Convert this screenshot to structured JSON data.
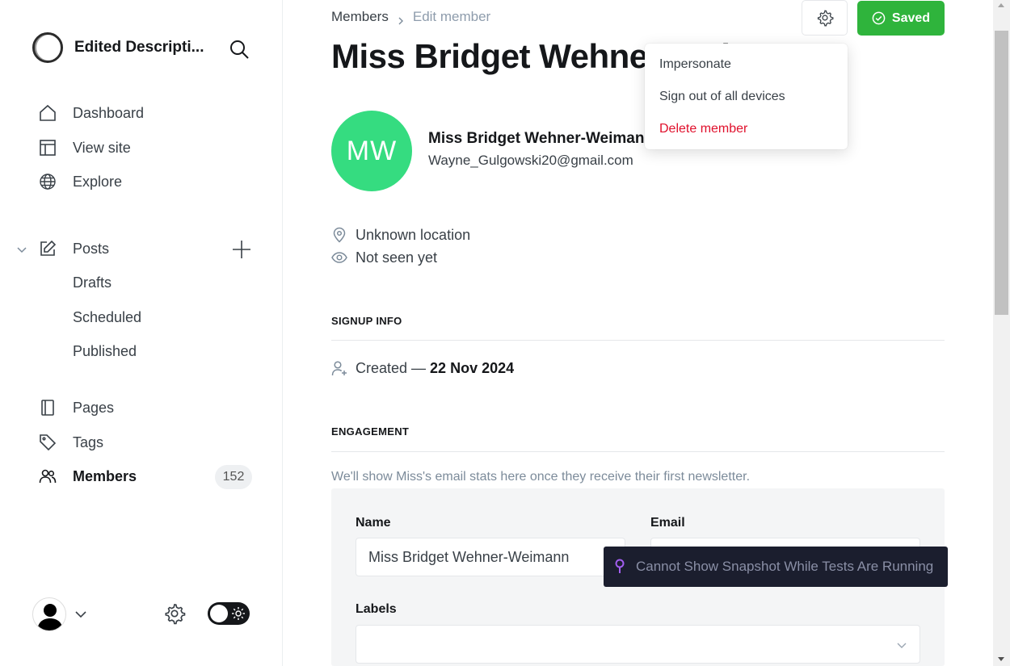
{
  "sidebar": {
    "site_name": "Edited Descripti...",
    "nav": {
      "dashboard": "Dashboard",
      "view_site": "View site",
      "explore": "Explore",
      "posts": "Posts",
      "drafts": "Drafts",
      "scheduled": "Scheduled",
      "published": "Published",
      "pages": "Pages",
      "tags": "Tags",
      "members": "Members",
      "members_count": "152"
    }
  },
  "header": {
    "breadcrumb_parent": "Members",
    "breadcrumb_current": "Edit member",
    "title": "Miss Bridget Wehner-Weimann",
    "saved_label": "Saved"
  },
  "settings_menu": {
    "impersonate": "Impersonate",
    "sign_out": "Sign out of all devices",
    "delete": "Delete member"
  },
  "member": {
    "initials": "MW",
    "name": "Miss Bridget Wehner-Weimann",
    "email": "Wayne_Gulgowski20@gmail.com",
    "location": "Unknown location",
    "seen": "Not seen yet"
  },
  "signup": {
    "heading": "SIGNUP INFO",
    "created_label": "Created —",
    "created_date": "22 Nov 2024"
  },
  "engagement": {
    "heading": "ENGAGEMENT",
    "note": "We'll show Miss's email stats here once they receive their first newsletter."
  },
  "form": {
    "name_label": "Name",
    "name_value": "Miss Bridget Wehner-Weimann",
    "email_label": "Email",
    "email_value": "",
    "labels_label": "Labels"
  },
  "toast": {
    "text": "Cannot Show Snapshot While Tests Are Running"
  },
  "colors": {
    "accent_green": "#2fb43c",
    "avatar_green": "#35dc80",
    "danger_red": "#e0102c",
    "toast_bg": "#1b1e2e"
  }
}
